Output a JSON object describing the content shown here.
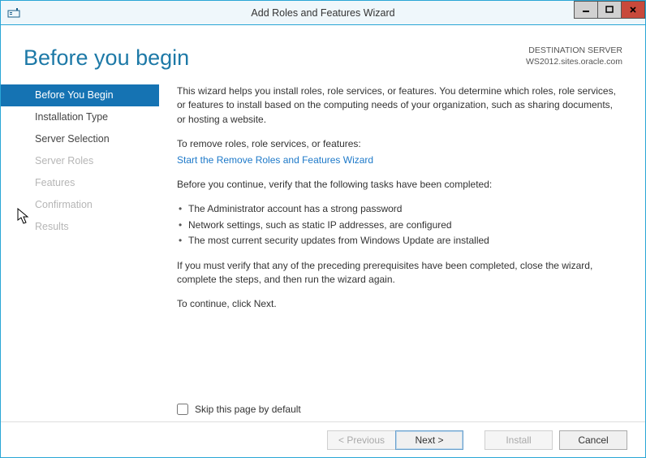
{
  "window": {
    "title": "Add Roles and Features Wizard"
  },
  "header": {
    "page_title": "Before you begin",
    "dest_label": "DESTINATION SERVER",
    "dest_server": "WS2012.sites.oracle.com"
  },
  "sidebar": {
    "items": [
      {
        "label": "Before You Begin",
        "state": "active"
      },
      {
        "label": "Installation Type",
        "state": "enabled"
      },
      {
        "label": "Server Selection",
        "state": "enabled"
      },
      {
        "label": "Server Roles",
        "state": "disabled"
      },
      {
        "label": "Features",
        "state": "disabled"
      },
      {
        "label": "Confirmation",
        "state": "disabled"
      },
      {
        "label": "Results",
        "state": "disabled"
      }
    ]
  },
  "main": {
    "intro": "This wizard helps you install roles, role services, or features. You determine which roles, role services, or features to install based on the computing needs of your organization, such as sharing documents, or hosting a website.",
    "remove_label": "To remove roles, role services, or features:",
    "remove_link": "Start the Remove Roles and Features Wizard",
    "verify_heading": "Before you continue, verify that the following tasks have been completed:",
    "bullets": [
      "The Administrator account has a strong password",
      "Network settings, such as static IP addresses, are configured",
      "The most current security updates from Windows Update are installed"
    ],
    "close_note": "If you must verify that any of the preceding prerequisites have been completed, close the wizard, complete the steps, and then run the wizard again.",
    "continue_note": "To continue, click Next.",
    "skip_label": "Skip this page by default"
  },
  "footer": {
    "previous": "< Previous",
    "next": "Next >",
    "install": "Install",
    "cancel": "Cancel"
  }
}
